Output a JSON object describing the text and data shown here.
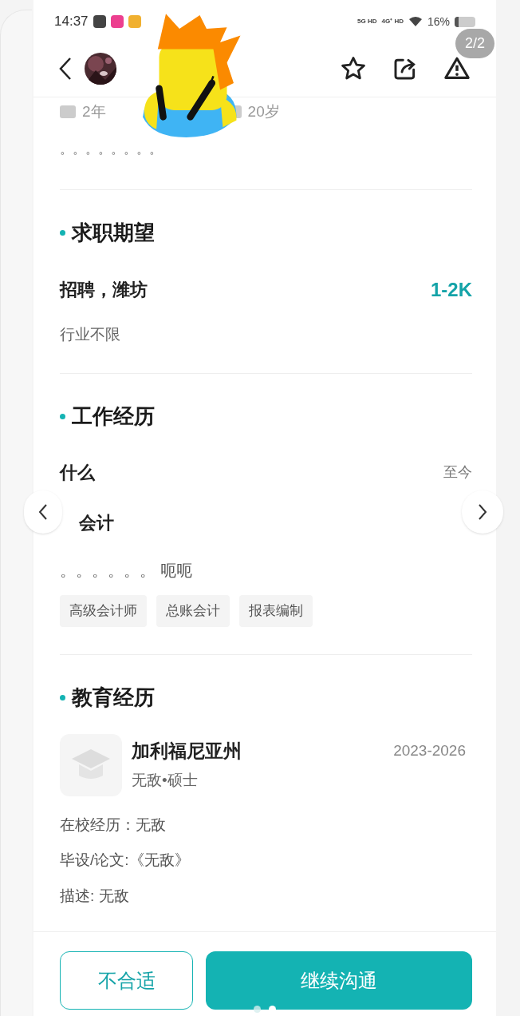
{
  "status_bar": {
    "time": "14:37",
    "net1": "5G HD",
    "net2": "4G⁺ HD",
    "battery": "16%"
  },
  "pager": "2/2",
  "profile": {
    "experience": "2年",
    "age": "20岁",
    "intro": "。。。。。。。。"
  },
  "expectation": {
    "title": "求职期望",
    "position": "招聘，潍坊",
    "salary": "1-2K",
    "industry": "行业不限"
  },
  "work": {
    "title": "工作经历",
    "company": "什么",
    "period": "至今",
    "position": "会计",
    "description": "。。。。。。 呃呃",
    "tags": [
      "高级会计师",
      "总账会计",
      "报表编制"
    ]
  },
  "education": {
    "title": "教育经历",
    "school": "加利福尼亚州",
    "years": "2023-2026",
    "degree": "无敌•硕士",
    "lines": [
      "在校经历：无敌",
      "毕设/论文:《无敌》",
      "描述: 无敌"
    ]
  },
  "buttons": {
    "reject": "不合适",
    "continue": "继续沟通"
  },
  "page_dots": [
    {
      "selected": false
    },
    {
      "selected": true
    }
  ]
}
